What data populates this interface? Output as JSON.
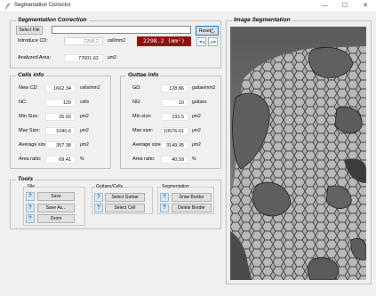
{
  "window": {
    "title": "Segmentation Corrector",
    "minimize": "—",
    "maximize": "☐",
    "close": "✕"
  },
  "segmentation_correction": {
    "title": "Segmentation Correction",
    "select_file_label": "Select File",
    "file_path": "",
    "introduce_cd_label": "Introduce CD:",
    "introduce_cd_value": "2298.2",
    "introduce_cd_unit": "cell/mm2",
    "cd_display": "2298.2 (mm²)",
    "analyzed_area_label": "Analyzed Area:",
    "analyzed_area_value": "77601.62",
    "analyzed_area_unit": "μm2",
    "reset_label": "Reset",
    "undo_icon": "undo-icon",
    "redo_icon": "redo-icon"
  },
  "cells_info": {
    "title": "Cells info",
    "rows": [
      {
        "label": "New CD:",
        "value": "1662.34",
        "unit": "cells/mm2"
      },
      {
        "label": "NC:",
        "value": "129",
        "unit": "cells"
      },
      {
        "label": "Min Size:",
        "value": "26.65",
        "unit": "μm2"
      },
      {
        "label": "Max Size:",
        "value": "1040.6",
        "unit": "μm2"
      },
      {
        "label": "Average size:",
        "value": "357.38",
        "unit": "μm2"
      },
      {
        "label": "Area ratio:",
        "value": "69.41",
        "unit": "%"
      }
    ]
  },
  "guttae_info": {
    "title": "Guttae info",
    "rows": [
      {
        "label": "GD:",
        "value": "128.86",
        "unit": "guttae/mm2"
      },
      {
        "label": "NG:",
        "value": "10",
        "unit": "guttaes"
      },
      {
        "label": "Min size:",
        "value": "233.5",
        "unit": "μm2"
      },
      {
        "label": "Max size:",
        "value": "10576.61",
        "unit": "μm2"
      },
      {
        "label": "Average size:",
        "value": "3149.95",
        "unit": "μm2"
      },
      {
        "label": "Area ratio:",
        "value": "40.59",
        "unit": "%"
      }
    ]
  },
  "tools": {
    "title": "Tools",
    "file": {
      "title": "File",
      "save": "Save",
      "save_as": "Save As...",
      "zoom": "Zoom"
    },
    "guttae_cells": {
      "title": "Guttaes/Cells",
      "select_guttae": "Select Guttae",
      "select_cell": "Select Cell"
    },
    "segmentation": {
      "title": "Segmentation",
      "draw_border": "Draw Border",
      "delete_border": "Delete Border"
    },
    "help_glyph": "?"
  },
  "image_segmentation": {
    "title": "Image Segmentation"
  },
  "colors": {
    "cd_display_bg": "#8b1010",
    "cd_display_fg": "#ffffff",
    "help_blue": "#1f5fa8"
  }
}
